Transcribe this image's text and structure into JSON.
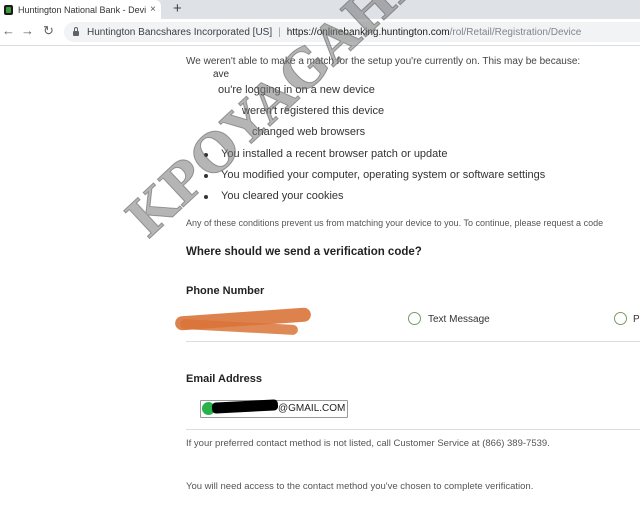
{
  "browser": {
    "tab_title": "Huntington National Bank - Devi",
    "tab_close": "×",
    "new_tab": "+",
    "back": "←",
    "forward": "→",
    "reload": "↻",
    "site_org": "Huntington Bancshares Incorporated [US]",
    "url_sep": "|",
    "url_host": "https://onlinebanking.huntington.com",
    "url_path": "/rol/Retail/Registration/Device"
  },
  "page": {
    "intro": "We weren't able to make a match for the setup you're currently on. This may be because:",
    "partial_lines": [
      "ave",
      "ou're logging in on a new device",
      "weren't registered this device",
      "changed web browsers"
    ],
    "reasons": [
      "You installed a recent browser patch or update",
      "You modified your computer, operating system or software settings",
      "You cleared your cookies"
    ],
    "conditions": "Any of these conditions prevent us from matching your device to you. To continue, please request a code",
    "question": "Where should we send a verification code?",
    "phone_label": "Phone Number",
    "text_message": "Text Message",
    "phone_option_partial": "P",
    "email_label": "Email Address",
    "email_value": "@GMAIL.COM",
    "contact_note": "If your preferred contact method is not listed, call Customer Service at (866) 389-7539.",
    "access_note": "You will need access to the contact method you've chosen to complete verification."
  },
  "watermark": "KPOYAGAHACK",
  "colors": {
    "accent": "#2bb14a",
    "redaction_orange": "#d9743a"
  }
}
